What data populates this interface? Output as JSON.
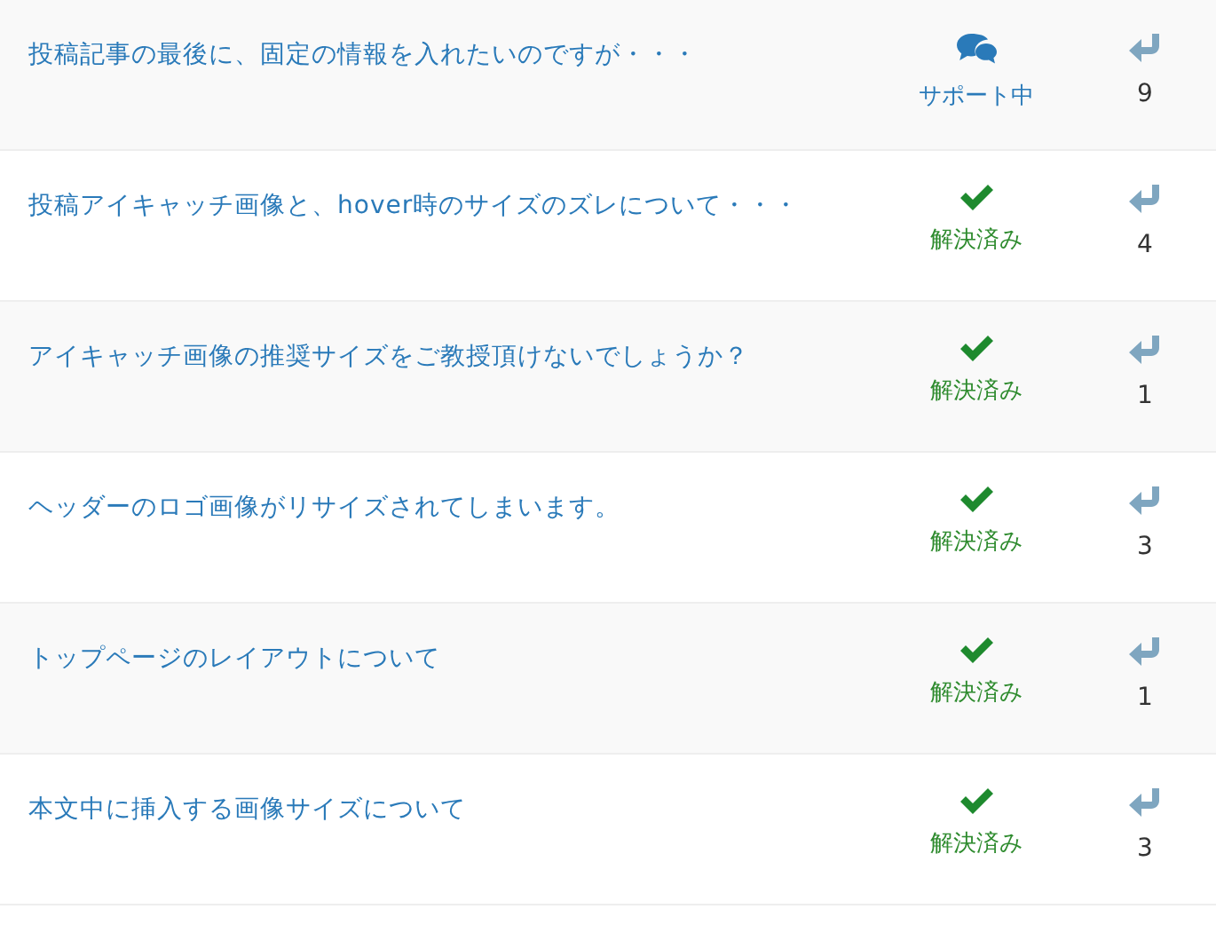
{
  "topics": [
    {
      "title": "投稿記事の最後に、固定の情報を入れたいのですが・・・",
      "status": {
        "kind": "support",
        "label": "サポート中"
      },
      "replies": "9"
    },
    {
      "title": "投稿アイキャッチ画像と、hover時のサイズのズレについて・・・",
      "status": {
        "kind": "resolved",
        "label": "解決済み"
      },
      "replies": "4"
    },
    {
      "title": "アイキャッチ画像の推奨サイズをご教授頂けないでしょうか？",
      "status": {
        "kind": "resolved",
        "label": "解決済み"
      },
      "replies": "1"
    },
    {
      "title": "ヘッダーのロゴ画像がリサイズされてしまいます。",
      "status": {
        "kind": "resolved",
        "label": "解決済み"
      },
      "replies": "3"
    },
    {
      "title": "トップページのレイアウトについて",
      "status": {
        "kind": "resolved",
        "label": "解決済み"
      },
      "replies": "1"
    },
    {
      "title": "本文中に挿入する画像サイズについて",
      "status": {
        "kind": "resolved",
        "label": "解決済み"
      },
      "replies": "3"
    }
  ]
}
